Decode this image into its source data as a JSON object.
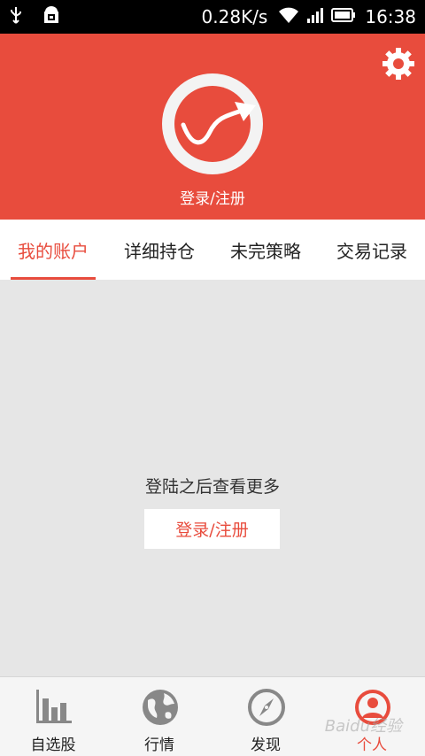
{
  "status_bar": {
    "speed": "0.28K/s",
    "time": "16:38",
    "icons": [
      "usb-icon",
      "android-debug-icon",
      "wifi-icon",
      "signal-icon",
      "battery-icon"
    ]
  },
  "header": {
    "login_label": "登录/注册",
    "settings_icon": "gear-icon",
    "accent_color": "#e84c3d"
  },
  "tabs": [
    {
      "label": "我的账户",
      "active": true
    },
    {
      "label": "详细持仓",
      "active": false
    },
    {
      "label": "未完策略",
      "active": false
    },
    {
      "label": "交易记录",
      "active": false
    }
  ],
  "content": {
    "prompt": "登陆之后查看更多",
    "login_button": "登录/注册"
  },
  "bottom_nav": [
    {
      "label": "自选股",
      "icon": "bar-chart-icon",
      "active": false
    },
    {
      "label": "行情",
      "icon": "globe-icon",
      "active": false
    },
    {
      "label": "发现",
      "icon": "compass-icon",
      "active": false
    },
    {
      "label": "个人",
      "icon": "person-icon",
      "active": true
    }
  ],
  "watermark": "Baidu经验"
}
